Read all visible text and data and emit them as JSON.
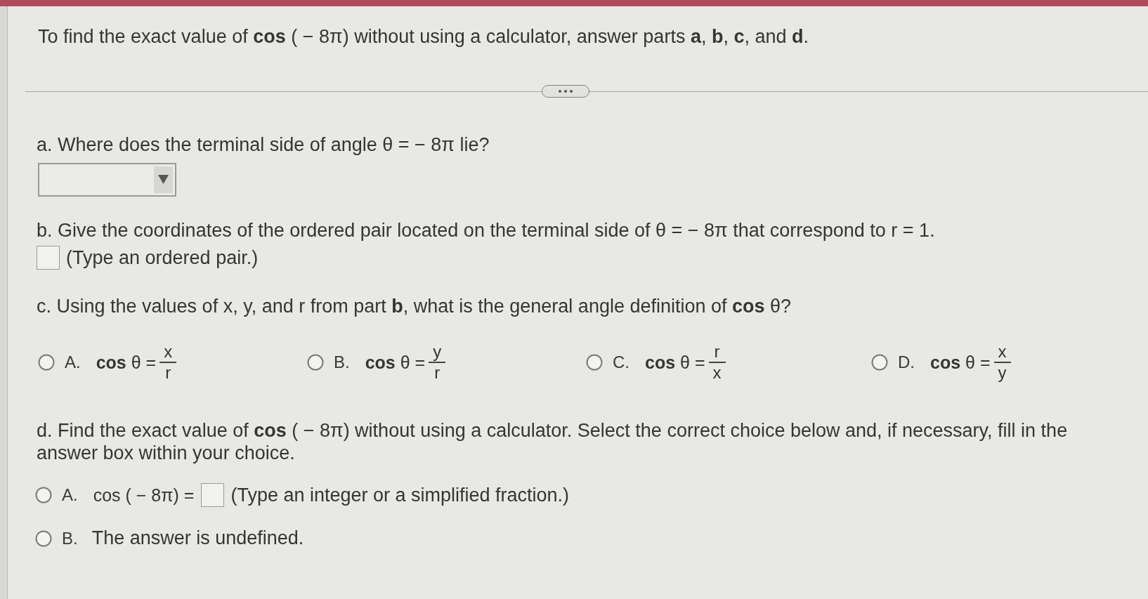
{
  "intro": "To find the exact value of **cos** ( − 8π) without using a calculator, answer parts **a**, **b**, **c**, and **d**.",
  "part_a": {
    "prompt": "a. Where does the terminal side of angle θ = − 8π lie?"
  },
  "part_b": {
    "prompt": "b. Give the coordinates of the ordered pair located on the terminal side of θ = − 8π that correspond to r = 1.",
    "hint": "(Type an ordered pair.)"
  },
  "part_c": {
    "prompt": "c. Using the values of x, y, and r from part **b**, what is the general angle definition of **cos** θ?",
    "options": [
      {
        "letter": "A.",
        "lhs": "**cos** θ =",
        "numerator": "x",
        "denominator": "r",
        "selected": false
      },
      {
        "letter": "B.",
        "lhs": "**cos** θ =",
        "numerator": "y",
        "denominator": "r",
        "selected": false
      },
      {
        "letter": "C.",
        "lhs": "**cos** θ =",
        "numerator": "r",
        "denominator": "x",
        "selected": false
      },
      {
        "letter": "D.",
        "lhs": "**cos** θ =",
        "numerator": "x",
        "denominator": "y",
        "selected": false
      }
    ]
  },
  "part_d": {
    "prompt": "d. Find the exact value of **cos** ( − 8π) without using a calculator. Select the correct choice below and, if necessary, fill in the answer box within your choice.",
    "options": [
      {
        "kind": "answer_box",
        "letter": "A.",
        "lhs": "cos ( − 8π) =",
        "hint": "(Type an integer or a simplified fraction.)",
        "selected": false
      },
      {
        "kind": "text",
        "letter": "B.",
        "text": "The answer is undefined.",
        "selected": false
      }
    ]
  }
}
